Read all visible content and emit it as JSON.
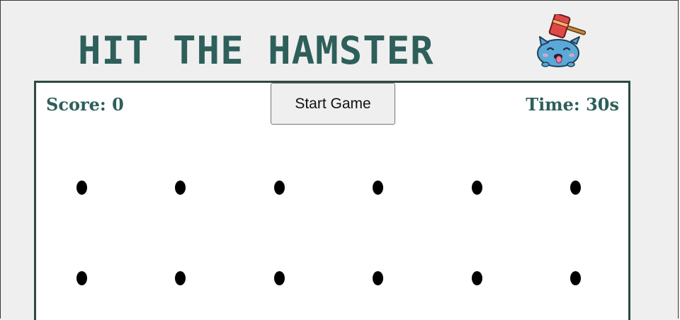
{
  "header": {
    "title": "HIT THE HAMSTER",
    "logo_icon": "hamster-with-mallet-icon"
  },
  "game": {
    "score_text": "Score: 0",
    "time_text": "Time: 30s",
    "start_label": "Start Game",
    "holes": {
      "rows": 2,
      "cols": 6,
      "visible_count": 12
    }
  },
  "colors": {
    "title": "#2e5f5a",
    "board_border": "#2c4a44",
    "page_bg": "#efefef",
    "board_bg": "#ffffff",
    "hole": "#000000",
    "hamster_body": "#5aa9d8",
    "mallet": "#e04848"
  }
}
